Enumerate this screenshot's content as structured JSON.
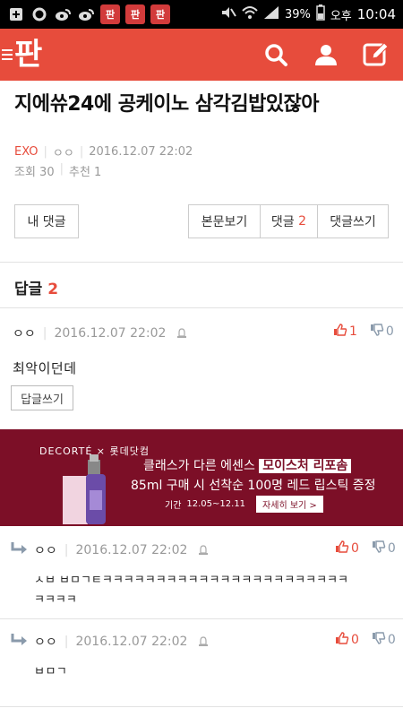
{
  "statusbar": {
    "pan_label": "판",
    "battery": "39%",
    "ampm": "오후",
    "time": "10:04"
  },
  "header": {
    "logo": "판",
    "icons": [
      "search-icon",
      "user-icon",
      "write-icon"
    ]
  },
  "post": {
    "title": "지에쓔24에 공케이노 삼각김밥있잖아",
    "category": "EXO",
    "author": "ㅇㅇ",
    "datetime": "2016.12.07 22:02",
    "views_label": "조회 30",
    "recommend_label": "추천 1"
  },
  "buttons": {
    "my_comments": "내 댓글",
    "view_body": "본문보기",
    "comments_label": "댓글",
    "comments_count": "2",
    "write_comment": "댓글쓰기"
  },
  "replies_header": {
    "label": "답글",
    "count": "2"
  },
  "comments": [
    {
      "author": "ㅇㅇ",
      "datetime": "2016.12.07 22:02",
      "up": "1",
      "down": "0",
      "text": "최악이던데",
      "reply_button": "답글쓰기"
    },
    {
      "author": "ㅇㅇ",
      "datetime": "2016.12.07 22:02",
      "up": "0",
      "down": "0",
      "text_line1": "ㅅㅂ ㅂㅁㄱㅌㅋㅋㅋㅋㅋㅋㅋㅋㅋㅋㅋㅋㅋㅋㅋㅋㅋㅋㅋㅋㅋㅋㅋ",
      "text_line2": "ㅋㅋㅋㅋ"
    },
    {
      "author": "ㅇㅇ",
      "datetime": "2016.12.07 22:02",
      "up": "0",
      "down": "0",
      "text": "ㅂㅁㄱ"
    }
  ],
  "ad": {
    "brand": "DECORTÉ × 롯데닷컴",
    "line1_a": "클래스가 다른 에센스",
    "line1_hl": "모이스처 리포솜",
    "line2": "85ml 구매 시 선착순 100명 레드 립스틱 증정",
    "period_label": "기간",
    "period": "12.05~12.11",
    "more": "자세히 보기 >"
  },
  "colors": {
    "accent": "#e74c3c",
    "ad_bg": "#7c0f27"
  }
}
